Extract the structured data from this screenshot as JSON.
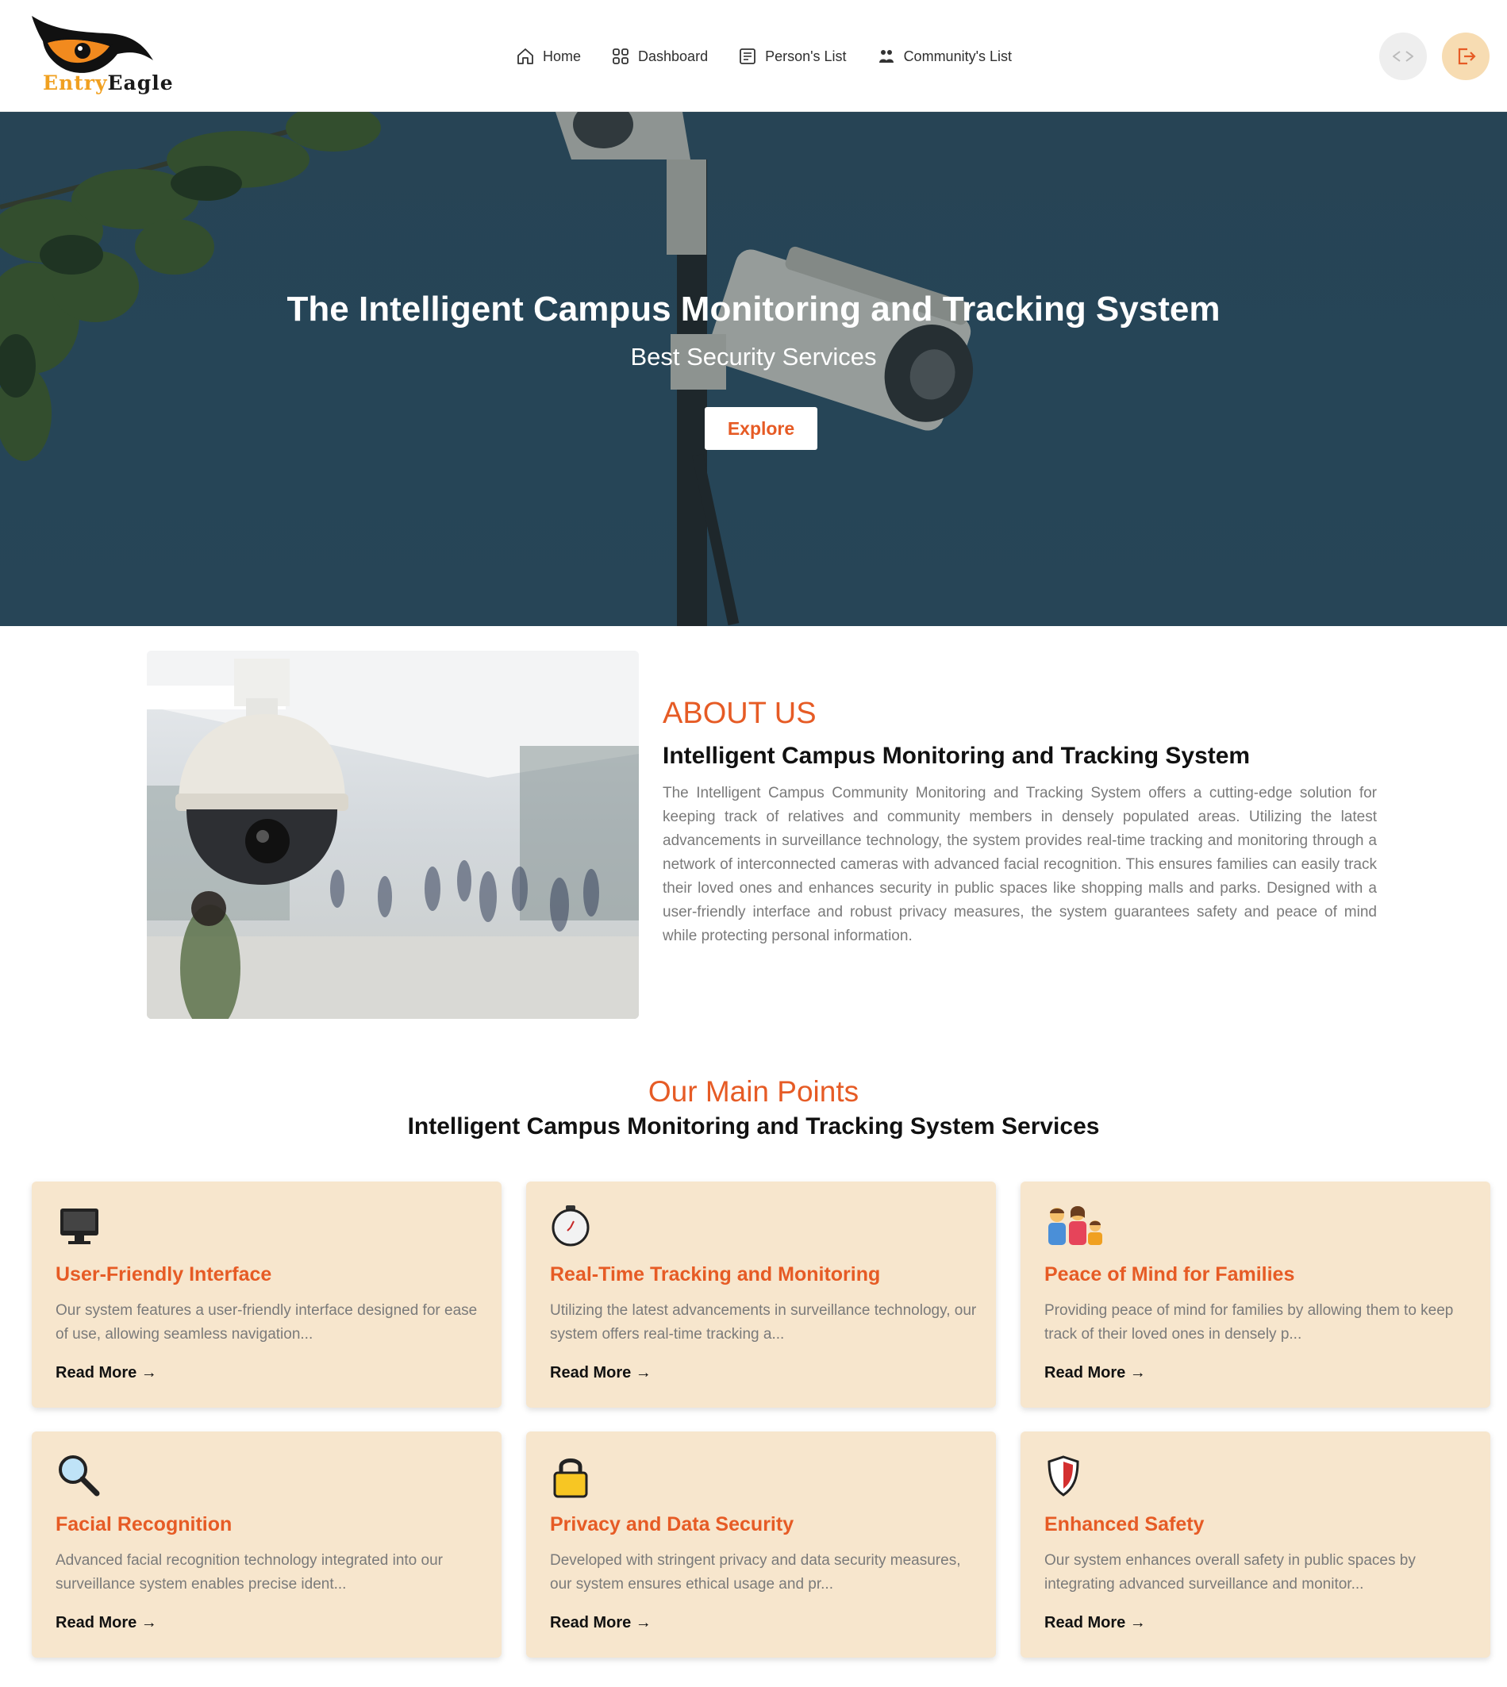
{
  "brand": {
    "logo_word1": "Entry",
    "logo_word2": "Eagle",
    "accent": "#e65b25",
    "logo_orange": "#f0a020"
  },
  "nav": {
    "items": [
      {
        "label": "Home",
        "icon": "home-icon"
      },
      {
        "label": "Dashboard",
        "icon": "dashboard-icon"
      },
      {
        "label": "Person's List",
        "icon": "list-icon"
      },
      {
        "label": "Community's List",
        "icon": "community-icon"
      }
    ],
    "theme_toggle_icon": "code-brackets-icon",
    "logout_icon": "logout-icon"
  },
  "hero": {
    "title": "The Intelligent Campus Monitoring and Tracking System",
    "subtitle": "Best Security Services",
    "button_label": "Explore",
    "background": "#2b4b5e"
  },
  "about": {
    "eyebrow": "ABOUT US",
    "title": "Intelligent Campus Monitoring and Tracking System",
    "text": "The Intelligent Campus Community Monitoring and Tracking System offers a cutting-edge solution for keeping track of relatives and community members in densely populated areas. Utilizing the latest advancements in surveillance technology, the system provides real-time tracking and monitoring through a network of interconnected cameras with advanced facial recognition. This ensures families can easily track their loved ones and enhances security in public spaces like shopping malls and parks. Designed with a user-friendly interface and robust privacy measures, the system guarantees safety and peace of mind while protecting personal information."
  },
  "points": {
    "eyebrow": "Our Main Points",
    "title": "Intelligent Campus Monitoring and Tracking System Services",
    "card_bg": "#f7e6cd",
    "cards": [
      {
        "icon": "monitor-icon",
        "title": "User-Friendly Interface",
        "text": "Our system features a user-friendly interface designed for ease of use, allowing seamless navigation...",
        "link": "Read More →"
      },
      {
        "icon": "stopwatch-icon",
        "title": "Real-Time Tracking and Monitoring",
        "text": "Utilizing the latest advancements in surveillance technology, our system offers real-time tracking a...",
        "link": "Read More →"
      },
      {
        "icon": "family-icon",
        "title": "Peace of Mind for Families",
        "text": "Providing peace of mind for families by allowing them to keep track of their loved ones in densely p...",
        "link": "Read More →"
      },
      {
        "icon": "magnifier-icon",
        "title": "Facial Recognition",
        "text": "Advanced facial recognition technology integrated into our surveillance system enables precise ident...",
        "link": "Read More →"
      },
      {
        "icon": "lock-icon",
        "title": "Privacy and Data Security",
        "text": "Developed with stringent privacy and data security measures, our system ensures ethical usage and pr...",
        "link": "Read More →"
      },
      {
        "icon": "shield-icon",
        "title": "Enhanced Safety",
        "text": "Our system enhances overall safety in public spaces by integrating advanced surveillance and monitor...",
        "link": "Read More →"
      }
    ]
  }
}
